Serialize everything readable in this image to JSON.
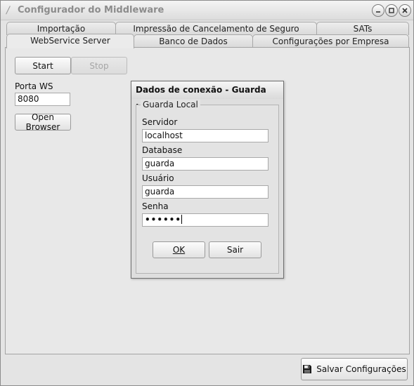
{
  "window": {
    "title": "Configurador do Middleware",
    "icon": "app-logo-icon"
  },
  "tabs_row1": [
    {
      "label": "Importação"
    },
    {
      "label": "Impressão de Cancelamento de Seguro"
    },
    {
      "label": "SATs"
    }
  ],
  "tabs_row2": [
    {
      "label": "WebService Server",
      "active": true
    },
    {
      "label": "Banco de Dados"
    },
    {
      "label": "Configurações por Empresa"
    }
  ],
  "webservice": {
    "start_label": "Start",
    "stop_label": "Stop",
    "porta_label": "Porta WS",
    "porta_value": "8080",
    "open_browser_label": "Open Browser"
  },
  "dialog": {
    "title": "Dados de conexão - Guarda Local",
    "group_title": "Guarda Local",
    "servidor_label": "Servidor",
    "servidor_value": "localhost",
    "database_label": "Database",
    "database_value": "guarda",
    "usuario_label": "Usuário",
    "usuario_value": "guarda",
    "senha_label": "Senha",
    "senha_value": "••••••",
    "ok_label": "OK",
    "sair_label": "Sair"
  },
  "footer": {
    "save_label": "Salvar Configurações",
    "save_icon": "floppy-disk-icon"
  }
}
